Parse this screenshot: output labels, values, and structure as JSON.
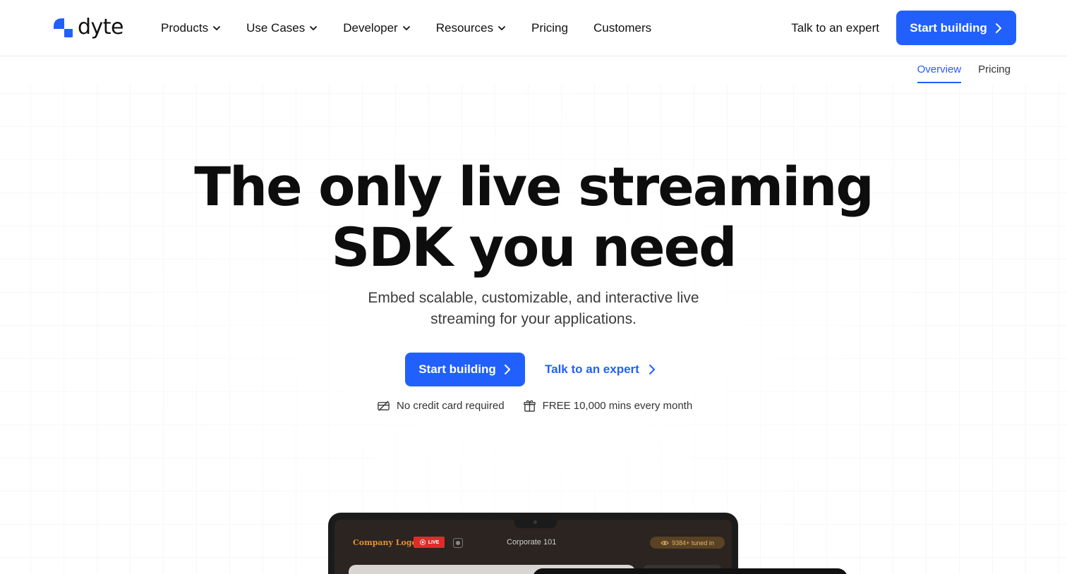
{
  "brand": {
    "name": "dyte",
    "accent": "#2160fd"
  },
  "nav": {
    "items": [
      {
        "label": "Products",
        "dropdown": true,
        "icon": "chevron-down-icon"
      },
      {
        "label": "Use Cases",
        "dropdown": true,
        "icon": "chevron-down-icon"
      },
      {
        "label": "Developer",
        "dropdown": true,
        "icon": "chevron-down-icon"
      },
      {
        "label": "Resources",
        "dropdown": true,
        "icon": "chevron-down-icon"
      },
      {
        "label": "Pricing",
        "dropdown": false
      },
      {
        "label": "Customers",
        "dropdown": false
      }
    ],
    "talk_label": "Talk to an expert",
    "cta_label": "Start building",
    "cta_icon": "chevron-right-icon"
  },
  "subnav": {
    "tabs": [
      {
        "label": "Overview",
        "active": true
      },
      {
        "label": "Pricing",
        "active": false
      }
    ]
  },
  "hero": {
    "headline_line1": "The only live streaming",
    "headline_line2": "SDK you need",
    "subline_line1": "Embed scalable, customizable, and interactive live",
    "subline_line2": "streaming for your applications.",
    "cta_label": "Start building",
    "talk_label": "Talk to an expert",
    "perks": [
      {
        "icon": "no-credit-card-icon",
        "label": "No credit card required"
      },
      {
        "icon": "gift-icon",
        "label": "FREE 10,000 mins every month"
      }
    ]
  },
  "mockup": {
    "company_logo": "Company Logo",
    "live_label": "LIVE",
    "stream_title": "Corporate 101",
    "viewers": "9384+ tuned in"
  }
}
